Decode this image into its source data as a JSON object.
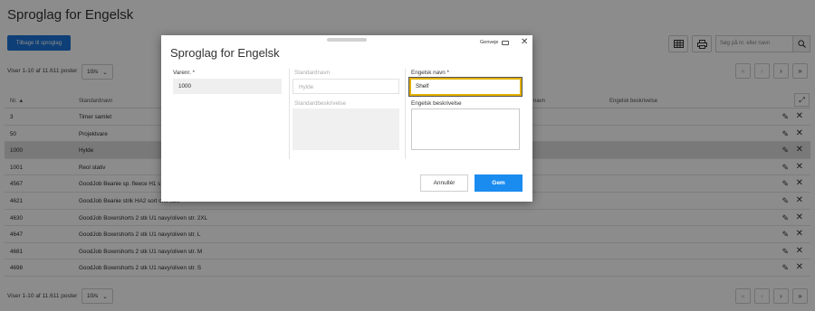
{
  "page": {
    "title": "Sproglag for Engelsk",
    "back_button": "Tilbage til sproglag",
    "search_placeholder": "Søg på nr. eller navn",
    "count_text": "Viser 1-10 af 11.611 poster",
    "per_page": "10/s"
  },
  "pager": {
    "first": "«",
    "prev": "‹",
    "next": "›",
    "last": "»"
  },
  "table": {
    "columns": [
      "Nr. ▲",
      "Standardnavn",
      "navn",
      "Engelsk beskrivelse"
    ],
    "rows": [
      {
        "nr": "3",
        "name": "Timer samlet"
      },
      {
        "nr": "50",
        "name": "Projektvare"
      },
      {
        "nr": "1000",
        "name": "Hylde"
      },
      {
        "nr": "1001",
        "name": "Reol stativ"
      },
      {
        "nr": "4567",
        "name": "GoodJob Beanie sp. fleece H1 s"
      },
      {
        "nr": "4621",
        "name": "GoodJob Beanie strik HA2 sort one size"
      },
      {
        "nr": "4630",
        "name": "GoodJob Boxershorts 2 stk U1 navy/oliven str. 2XL"
      },
      {
        "nr": "4647",
        "name": "GoodJob Boxershorts 2 stk U1 navy/oliven str. L"
      },
      {
        "nr": "4681",
        "name": "GoodJob Boxershorts 2 stk U1 navy/oliven str. M"
      },
      {
        "nr": "4698",
        "name": "GoodJob Boxershorts 2 stk U1 navy/oliven str. S"
      }
    ]
  },
  "modal": {
    "title": "Sproglag for Engelsk",
    "shortcut_label": "Genveje",
    "close": "✕",
    "varenr_label": "Varenr. *",
    "varenr_value": "1000",
    "standardnavn_label": "Standardnavn",
    "standardnavn_value": "Hylde",
    "standardbeskrivelse_label": "Standardbeskrivelse",
    "engelsk_navn_label": "Engelsk navn *",
    "engelsk_navn_value": "Shelf",
    "engelsk_beskrivelse_label": "Engelsk beskrivelse",
    "cancel_button": "Annullér",
    "save_button": "Gem"
  },
  "colors": {
    "primary": "#1a73d9",
    "save": "#1a8cf0",
    "focus": "#e2b000"
  }
}
